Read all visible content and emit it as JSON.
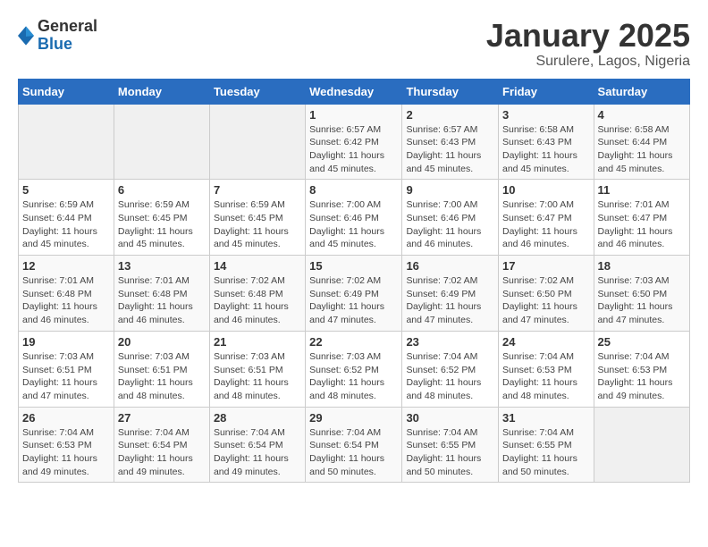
{
  "header": {
    "logo_general": "General",
    "logo_blue": "Blue",
    "month_title": "January 2025",
    "location": "Surulere, Lagos, Nigeria"
  },
  "days_of_week": [
    "Sunday",
    "Monday",
    "Tuesday",
    "Wednesday",
    "Thursday",
    "Friday",
    "Saturday"
  ],
  "weeks": [
    [
      {
        "day": "",
        "info": ""
      },
      {
        "day": "",
        "info": ""
      },
      {
        "day": "",
        "info": ""
      },
      {
        "day": "1",
        "info": "Sunrise: 6:57 AM\nSunset: 6:42 PM\nDaylight: 11 hours and 45 minutes."
      },
      {
        "day": "2",
        "info": "Sunrise: 6:57 AM\nSunset: 6:43 PM\nDaylight: 11 hours and 45 minutes."
      },
      {
        "day": "3",
        "info": "Sunrise: 6:58 AM\nSunset: 6:43 PM\nDaylight: 11 hours and 45 minutes."
      },
      {
        "day": "4",
        "info": "Sunrise: 6:58 AM\nSunset: 6:44 PM\nDaylight: 11 hours and 45 minutes."
      }
    ],
    [
      {
        "day": "5",
        "info": "Sunrise: 6:59 AM\nSunset: 6:44 PM\nDaylight: 11 hours and 45 minutes."
      },
      {
        "day": "6",
        "info": "Sunrise: 6:59 AM\nSunset: 6:45 PM\nDaylight: 11 hours and 45 minutes."
      },
      {
        "day": "7",
        "info": "Sunrise: 6:59 AM\nSunset: 6:45 PM\nDaylight: 11 hours and 45 minutes."
      },
      {
        "day": "8",
        "info": "Sunrise: 7:00 AM\nSunset: 6:46 PM\nDaylight: 11 hours and 45 minutes."
      },
      {
        "day": "9",
        "info": "Sunrise: 7:00 AM\nSunset: 6:46 PM\nDaylight: 11 hours and 46 minutes."
      },
      {
        "day": "10",
        "info": "Sunrise: 7:00 AM\nSunset: 6:47 PM\nDaylight: 11 hours and 46 minutes."
      },
      {
        "day": "11",
        "info": "Sunrise: 7:01 AM\nSunset: 6:47 PM\nDaylight: 11 hours and 46 minutes."
      }
    ],
    [
      {
        "day": "12",
        "info": "Sunrise: 7:01 AM\nSunset: 6:48 PM\nDaylight: 11 hours and 46 minutes."
      },
      {
        "day": "13",
        "info": "Sunrise: 7:01 AM\nSunset: 6:48 PM\nDaylight: 11 hours and 46 minutes."
      },
      {
        "day": "14",
        "info": "Sunrise: 7:02 AM\nSunset: 6:48 PM\nDaylight: 11 hours and 46 minutes."
      },
      {
        "day": "15",
        "info": "Sunrise: 7:02 AM\nSunset: 6:49 PM\nDaylight: 11 hours and 47 minutes."
      },
      {
        "day": "16",
        "info": "Sunrise: 7:02 AM\nSunset: 6:49 PM\nDaylight: 11 hours and 47 minutes."
      },
      {
        "day": "17",
        "info": "Sunrise: 7:02 AM\nSunset: 6:50 PM\nDaylight: 11 hours and 47 minutes."
      },
      {
        "day": "18",
        "info": "Sunrise: 7:03 AM\nSunset: 6:50 PM\nDaylight: 11 hours and 47 minutes."
      }
    ],
    [
      {
        "day": "19",
        "info": "Sunrise: 7:03 AM\nSunset: 6:51 PM\nDaylight: 11 hours and 47 minutes."
      },
      {
        "day": "20",
        "info": "Sunrise: 7:03 AM\nSunset: 6:51 PM\nDaylight: 11 hours and 48 minutes."
      },
      {
        "day": "21",
        "info": "Sunrise: 7:03 AM\nSunset: 6:51 PM\nDaylight: 11 hours and 48 minutes."
      },
      {
        "day": "22",
        "info": "Sunrise: 7:03 AM\nSunset: 6:52 PM\nDaylight: 11 hours and 48 minutes."
      },
      {
        "day": "23",
        "info": "Sunrise: 7:04 AM\nSunset: 6:52 PM\nDaylight: 11 hours and 48 minutes."
      },
      {
        "day": "24",
        "info": "Sunrise: 7:04 AM\nSunset: 6:53 PM\nDaylight: 11 hours and 48 minutes."
      },
      {
        "day": "25",
        "info": "Sunrise: 7:04 AM\nSunset: 6:53 PM\nDaylight: 11 hours and 49 minutes."
      }
    ],
    [
      {
        "day": "26",
        "info": "Sunrise: 7:04 AM\nSunset: 6:53 PM\nDaylight: 11 hours and 49 minutes."
      },
      {
        "day": "27",
        "info": "Sunrise: 7:04 AM\nSunset: 6:54 PM\nDaylight: 11 hours and 49 minutes."
      },
      {
        "day": "28",
        "info": "Sunrise: 7:04 AM\nSunset: 6:54 PM\nDaylight: 11 hours and 49 minutes."
      },
      {
        "day": "29",
        "info": "Sunrise: 7:04 AM\nSunset: 6:54 PM\nDaylight: 11 hours and 50 minutes."
      },
      {
        "day": "30",
        "info": "Sunrise: 7:04 AM\nSunset: 6:55 PM\nDaylight: 11 hours and 50 minutes."
      },
      {
        "day": "31",
        "info": "Sunrise: 7:04 AM\nSunset: 6:55 PM\nDaylight: 11 hours and 50 minutes."
      },
      {
        "day": "",
        "info": ""
      }
    ]
  ]
}
